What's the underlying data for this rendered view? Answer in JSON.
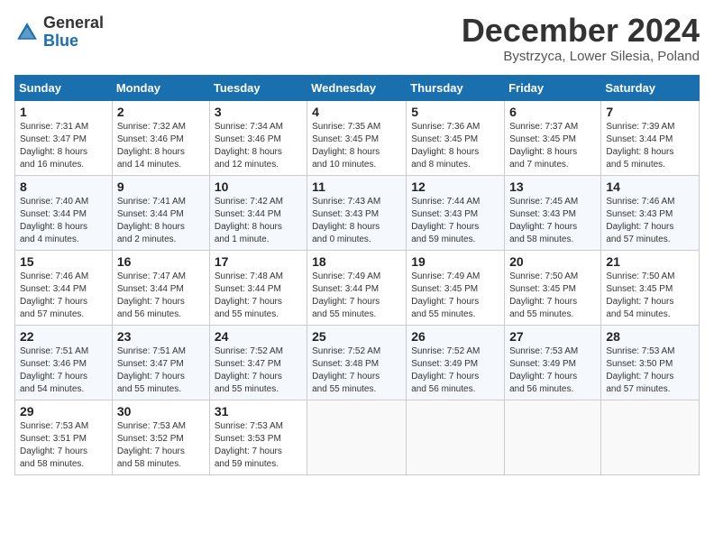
{
  "header": {
    "logo_general": "General",
    "logo_blue": "Blue",
    "month": "December 2024",
    "location": "Bystrzyca, Lower Silesia, Poland"
  },
  "days_of_week": [
    "Sunday",
    "Monday",
    "Tuesday",
    "Wednesday",
    "Thursday",
    "Friday",
    "Saturday"
  ],
  "weeks": [
    [
      {
        "day": 1,
        "info": "Sunrise: 7:31 AM\nSunset: 3:47 PM\nDaylight: 8 hours\nand 16 minutes."
      },
      {
        "day": 2,
        "info": "Sunrise: 7:32 AM\nSunset: 3:46 PM\nDaylight: 8 hours\nand 14 minutes."
      },
      {
        "day": 3,
        "info": "Sunrise: 7:34 AM\nSunset: 3:46 PM\nDaylight: 8 hours\nand 12 minutes."
      },
      {
        "day": 4,
        "info": "Sunrise: 7:35 AM\nSunset: 3:45 PM\nDaylight: 8 hours\nand 10 minutes."
      },
      {
        "day": 5,
        "info": "Sunrise: 7:36 AM\nSunset: 3:45 PM\nDaylight: 8 hours\nand 8 minutes."
      },
      {
        "day": 6,
        "info": "Sunrise: 7:37 AM\nSunset: 3:45 PM\nDaylight: 8 hours\nand 7 minutes."
      },
      {
        "day": 7,
        "info": "Sunrise: 7:39 AM\nSunset: 3:44 PM\nDaylight: 8 hours\nand 5 minutes."
      }
    ],
    [
      {
        "day": 8,
        "info": "Sunrise: 7:40 AM\nSunset: 3:44 PM\nDaylight: 8 hours\nand 4 minutes."
      },
      {
        "day": 9,
        "info": "Sunrise: 7:41 AM\nSunset: 3:44 PM\nDaylight: 8 hours\nand 2 minutes."
      },
      {
        "day": 10,
        "info": "Sunrise: 7:42 AM\nSunset: 3:44 PM\nDaylight: 8 hours\nand 1 minute."
      },
      {
        "day": 11,
        "info": "Sunrise: 7:43 AM\nSunset: 3:43 PM\nDaylight: 8 hours\nand 0 minutes."
      },
      {
        "day": 12,
        "info": "Sunrise: 7:44 AM\nSunset: 3:43 PM\nDaylight: 7 hours\nand 59 minutes."
      },
      {
        "day": 13,
        "info": "Sunrise: 7:45 AM\nSunset: 3:43 PM\nDaylight: 7 hours\nand 58 minutes."
      },
      {
        "day": 14,
        "info": "Sunrise: 7:46 AM\nSunset: 3:43 PM\nDaylight: 7 hours\nand 57 minutes."
      }
    ],
    [
      {
        "day": 15,
        "info": "Sunrise: 7:46 AM\nSunset: 3:44 PM\nDaylight: 7 hours\nand 57 minutes."
      },
      {
        "day": 16,
        "info": "Sunrise: 7:47 AM\nSunset: 3:44 PM\nDaylight: 7 hours\nand 56 minutes."
      },
      {
        "day": 17,
        "info": "Sunrise: 7:48 AM\nSunset: 3:44 PM\nDaylight: 7 hours\nand 55 minutes."
      },
      {
        "day": 18,
        "info": "Sunrise: 7:49 AM\nSunset: 3:44 PM\nDaylight: 7 hours\nand 55 minutes."
      },
      {
        "day": 19,
        "info": "Sunrise: 7:49 AM\nSunset: 3:45 PM\nDaylight: 7 hours\nand 55 minutes."
      },
      {
        "day": 20,
        "info": "Sunrise: 7:50 AM\nSunset: 3:45 PM\nDaylight: 7 hours\nand 55 minutes."
      },
      {
        "day": 21,
        "info": "Sunrise: 7:50 AM\nSunset: 3:45 PM\nDaylight: 7 hours\nand 54 minutes."
      }
    ],
    [
      {
        "day": 22,
        "info": "Sunrise: 7:51 AM\nSunset: 3:46 PM\nDaylight: 7 hours\nand 54 minutes."
      },
      {
        "day": 23,
        "info": "Sunrise: 7:51 AM\nSunset: 3:47 PM\nDaylight: 7 hours\nand 55 minutes."
      },
      {
        "day": 24,
        "info": "Sunrise: 7:52 AM\nSunset: 3:47 PM\nDaylight: 7 hours\nand 55 minutes."
      },
      {
        "day": 25,
        "info": "Sunrise: 7:52 AM\nSunset: 3:48 PM\nDaylight: 7 hours\nand 55 minutes."
      },
      {
        "day": 26,
        "info": "Sunrise: 7:52 AM\nSunset: 3:49 PM\nDaylight: 7 hours\nand 56 minutes."
      },
      {
        "day": 27,
        "info": "Sunrise: 7:53 AM\nSunset: 3:49 PM\nDaylight: 7 hours\nand 56 minutes."
      },
      {
        "day": 28,
        "info": "Sunrise: 7:53 AM\nSunset: 3:50 PM\nDaylight: 7 hours\nand 57 minutes."
      }
    ],
    [
      {
        "day": 29,
        "info": "Sunrise: 7:53 AM\nSunset: 3:51 PM\nDaylight: 7 hours\nand 58 minutes."
      },
      {
        "day": 30,
        "info": "Sunrise: 7:53 AM\nSunset: 3:52 PM\nDaylight: 7 hours\nand 58 minutes."
      },
      {
        "day": 31,
        "info": "Sunrise: 7:53 AM\nSunset: 3:53 PM\nDaylight: 7 hours\nand 59 minutes."
      },
      null,
      null,
      null,
      null
    ]
  ]
}
